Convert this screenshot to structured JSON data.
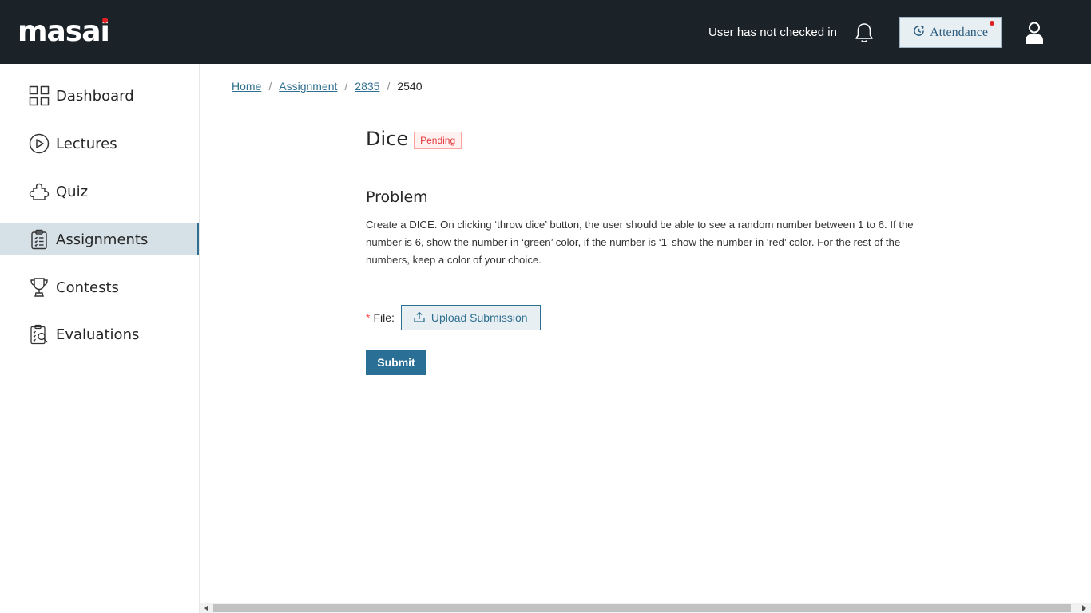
{
  "header": {
    "logo_text": "masai",
    "checkin_status": "User has not checked in",
    "attendance_label": "Attendance",
    "icons": [
      "bell-icon",
      "clock-icon",
      "user-icon"
    ],
    "bg_color": "#1b2329"
  },
  "sidebar": {
    "items": [
      {
        "label": "Dashboard",
        "icon": "grid-icon",
        "active": false
      },
      {
        "label": "Lectures",
        "icon": "play-circle-icon",
        "active": false
      },
      {
        "label": "Quiz",
        "icon": "puzzle-icon",
        "active": false
      },
      {
        "label": "Assignments",
        "icon": "clipboard-icon",
        "active": true
      },
      {
        "label": "Contests",
        "icon": "trophy-icon",
        "active": false
      },
      {
        "label": "Evaluations",
        "icon": "evaluation-icon",
        "active": false
      }
    ]
  },
  "breadcrumb": {
    "home": "Home",
    "assignment": "Assignment",
    "id1": "2835",
    "current": "2540",
    "separator": "/"
  },
  "assignment": {
    "title": "Dice",
    "status": "Pending",
    "problem_heading": "Problem",
    "problem_text": "Create a DICE. On clicking ‘throw dice’ button, the user should be able to see a random number between 1 to 6. If the number is 6, show the number in ‘green’ color, if the number is ‘1’ show the number in ‘red’ color. For the rest of the numbers, keep a color of your choice."
  },
  "form": {
    "required_mark": "*",
    "file_label": "File",
    "upload_label": "Upload Submission",
    "submit_label": "Submit"
  },
  "colors": {
    "accent": "#2a6f96",
    "active_bg": "#d5e1e6",
    "pending": "#e5383b"
  }
}
